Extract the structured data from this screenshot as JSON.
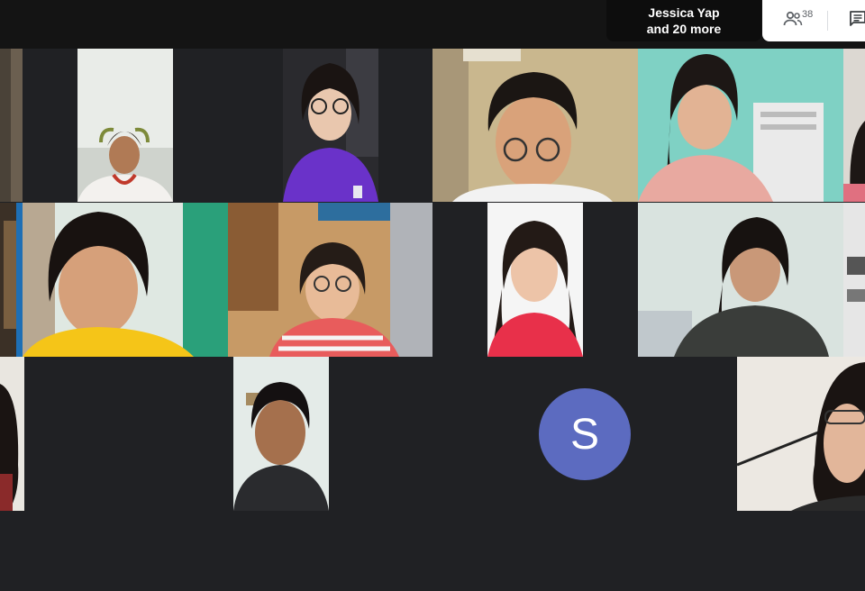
{
  "presenter": {
    "line1": "Jessica Yap",
    "line2": "and 20 more"
  },
  "controls": {
    "people_count": "38",
    "people_icon": "people-icon",
    "chat_icon": "chat-icon"
  },
  "avatar_tile": {
    "initial": "S",
    "color": "#5c6bc0"
  },
  "colors": {
    "background": "#202124",
    "topbar": "#141414",
    "accent_purple": "#6a32c9",
    "accent_red": "#d93043",
    "accent_yellow": "#f5c518"
  }
}
